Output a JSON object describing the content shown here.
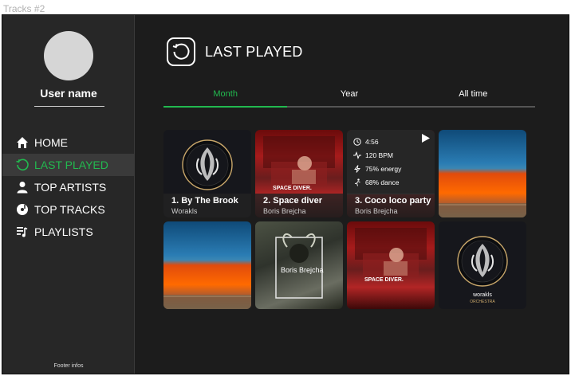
{
  "frame_title": "Tracks #2",
  "sidebar": {
    "username": "User name",
    "nav": [
      {
        "label": "HOME",
        "icon": "home-icon",
        "active": false
      },
      {
        "label": "LAST PLAYED",
        "icon": "history-icon",
        "active": true
      },
      {
        "label": "TOP ARTISTS",
        "icon": "user-icon",
        "active": false
      },
      {
        "label": "TOP TRACKS",
        "icon": "disc-icon",
        "active": false
      },
      {
        "label": "PLAYLISTS",
        "icon": "playlist-icon",
        "active": false
      }
    ],
    "footer": "Footer infos"
  },
  "header": {
    "title": "LAST PLAYED",
    "icon": "history-icon"
  },
  "tabs": [
    {
      "label": "Month",
      "active": true
    },
    {
      "label": "Year",
      "active": false
    },
    {
      "label": "All time",
      "active": false
    }
  ],
  "tracks": [
    {
      "title": "1. By The Brook",
      "artist": "Worakls",
      "art": "worakls"
    },
    {
      "title": "2. Space diver",
      "artist": "Boris Brejcha",
      "art": "car",
      "cover_text": "SPACE DIVER."
    },
    {
      "title": "3. Coco loco party",
      "artist": "Boris Brejcha",
      "art": "car",
      "stats": {
        "duration": "4:56",
        "bpm": "120 BPM",
        "energy": "75% energy",
        "dance": "68% dance"
      }
    },
    {
      "art": "pool"
    },
    {
      "art": "pool"
    },
    {
      "art": "boris",
      "cover_text": "Boris Brejcha"
    },
    {
      "art": "car",
      "cover_text": "SPACE DIVER."
    },
    {
      "art": "worakls",
      "cover_text": "worakls",
      "cover_subtext": "ORCHESTRA"
    }
  ],
  "colors": {
    "accent": "#22b94f",
    "background": "#1c1c1c",
    "sidebar": "#272727"
  }
}
